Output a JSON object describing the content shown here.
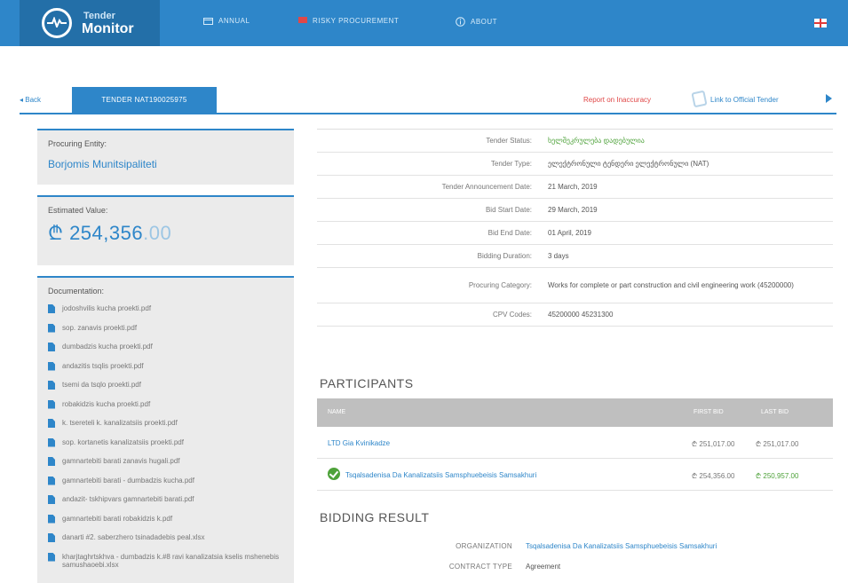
{
  "header": {
    "brand_line1": "Tender",
    "brand_line2": "Monitor",
    "nav": [
      {
        "label": "ANNUAL",
        "icon": "calendar-icon"
      },
      {
        "label": "RISKY PROCUREMENT",
        "icon": "warning-flag-icon"
      },
      {
        "label": "ABOUT",
        "icon": "info-icon"
      }
    ],
    "language_icon": "english-flag-icon"
  },
  "subheader": {
    "back_label": "Back",
    "tender_tab": "TENDER NAT190025975",
    "report_label": "Report on Inaccuracy",
    "official_label": "Link to Official Tender"
  },
  "left": {
    "procuring_label": "Procuring Entity:",
    "procuring_value": "Borjomis Munitsipaliteti",
    "estimated_label": "Estimated Value:",
    "estimated_main": "₾ 254,356",
    "estimated_cents": ".00",
    "documentation_label": "Documentation:",
    "documents": [
      "jodoshvilis kucha proekti.pdf",
      "sop. zanavis proekti.pdf",
      "dumbadzis kucha proekti.pdf",
      "andazitis tsqlis proekti.pdf",
      "tsemi da tsqlo proekti.pdf",
      "robakidzis kucha proekti.pdf",
      "k. tsereteli k. kanalizatsiis proekti.pdf",
      "sop. kortanetis kanalizatsiis proekti.pdf",
      "gamnartebiti barati zanavis hugali.pdf",
      "gamnartebiti barati - dumbadzis kucha.pdf",
      "andazit- tskhipvars gamnartebiti barati.pdf",
      "gamnartebiti barati robakidzis k.pdf",
      "danarti #2. saberzhero tsinadadebis peal.xlsx",
      "kharjtaghrtskhva - dumbadzis k.#8 ravi kanalizatsia kselis mshenebis samushaoebi.xlsx"
    ]
  },
  "details": [
    {
      "key": "Tender Status:",
      "value": "ხელშეკრულება დადებულია"
    },
    {
      "key": "Tender Type:",
      "value": "ელექტრონული ტენდერი ელექტრონული (NAT)"
    },
    {
      "key": "Tender Announcement Date:",
      "value": "21 March, 2019"
    },
    {
      "key": "Bid Start Date:",
      "value": "29 March, 2019"
    },
    {
      "key": "Bid End Date:",
      "value": "01 April, 2019"
    },
    {
      "key": "Bidding Duration:",
      "value": "3 days"
    },
    {
      "key": "Procuring Category:",
      "value": "Works for complete or part construction and civil engineering work (45200000)"
    },
    {
      "key": "CPV Codes:",
      "value": "45200000 45231300"
    }
  ],
  "participants": {
    "title": "PARTICIPANTS",
    "col_name": "NAME",
    "col_first": "FIRST BID",
    "col_last": "LAST BID",
    "rows": [
      {
        "name": "LTD Gia Kvinikadze",
        "first": "₾ 251,017.00",
        "last": "₾ 251,017.00",
        "winner": false
      },
      {
        "name": "Tsqalsadenisa Da Kanalizatsiis Samsphuebeisis Samsakhuri",
        "first": "₾ 254,356.00",
        "last": "₾ 250,957.00",
        "winner": true
      }
    ]
  },
  "bidding": {
    "title": "BIDDING RESULT",
    "organization_label": "ORGANIZATION",
    "organization_value": "Tsqalsadenisa Da Kanalizatsiis Samsphuebeisis Samsakhuri",
    "contract_label": "CONTRACT TYPE",
    "contract_value": "Agreement"
  }
}
